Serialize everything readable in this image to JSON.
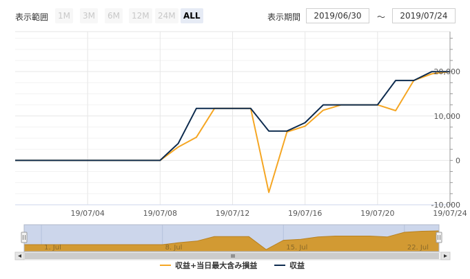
{
  "toolbar": {
    "range_label": "表示範囲",
    "range_buttons": [
      {
        "label": "1M",
        "active": false
      },
      {
        "label": "3M",
        "active": false
      },
      {
        "label": "6M",
        "active": false
      },
      {
        "label": "12M",
        "active": false
      },
      {
        "label": "24M",
        "active": false
      },
      {
        "label": "ALL",
        "active": true
      }
    ],
    "period_label": "表示期間",
    "start_date": "2019/06/30",
    "tilde": "～",
    "end_date": "2019/07/24"
  },
  "colors": {
    "series_orange": "#f5a623",
    "series_navy": "#0d2b4e",
    "navigator_fill": "#d29a33",
    "navigator_mask": "#ccd6eb",
    "grid": "#e6e6e6"
  },
  "chart_data": {
    "type": "line",
    "x_start": "2019/06/30",
    "x_end": "2019/07/24",
    "xticks": [
      "19/07/04",
      "19/07/08",
      "19/07/12",
      "19/07/16",
      "19/07/20",
      "19/07/24"
    ],
    "yticks": [
      "-10,000",
      "0",
      "10,000",
      "20,000"
    ],
    "ylim": [
      -10000,
      29000
    ],
    "grid": true,
    "legend_position": "bottom",
    "series": [
      {
        "name": "収益+当日最大含み損益",
        "color": "#f5a623",
        "x": [
          "2019/06/30",
          "2019/07/01",
          "2019/07/02",
          "2019/07/03",
          "2019/07/04",
          "2019/07/05",
          "2019/07/06",
          "2019/07/07",
          "2019/07/08",
          "2019/07/09",
          "2019/07/10",
          "2019/07/11",
          "2019/07/12",
          "2019/07/13",
          "2019/07/14",
          "2019/07/15",
          "2019/07/16",
          "2019/07/17",
          "2019/07/18",
          "2019/07/19",
          "2019/07/20",
          "2019/07/21",
          "2019/07/22",
          "2019/07/23",
          "2019/07/24"
        ],
        "values": [
          0,
          0,
          0,
          0,
          0,
          0,
          0,
          0,
          0,
          3000,
          5200,
          11700,
          11700,
          11700,
          -7200,
          6400,
          7700,
          11300,
          12500,
          12500,
          12500,
          11200,
          18000,
          19500,
          20000
        ]
      },
      {
        "name": "収益",
        "color": "#0d2b4e",
        "x": [
          "2019/06/30",
          "2019/07/01",
          "2019/07/02",
          "2019/07/03",
          "2019/07/04",
          "2019/07/05",
          "2019/07/06",
          "2019/07/07",
          "2019/07/08",
          "2019/07/09",
          "2019/07/10",
          "2019/07/11",
          "2019/07/12",
          "2019/07/13",
          "2019/07/14",
          "2019/07/15",
          "2019/07/16",
          "2019/07/17",
          "2019/07/18",
          "2019/07/19",
          "2019/07/20",
          "2019/07/21",
          "2019/07/22",
          "2019/07/23",
          "2019/07/24"
        ],
        "values": [
          0,
          0,
          0,
          0,
          0,
          0,
          0,
          0,
          0,
          3800,
          11700,
          11700,
          11700,
          11700,
          6600,
          6600,
          8500,
          12500,
          12500,
          12500,
          12500,
          18000,
          18000,
          20000,
          20000
        ]
      }
    ],
    "navigator": {
      "labels": [
        "1. Jul",
        "8. Jul",
        "15. Jul",
        "22. Jul"
      ],
      "label_dates": [
        "2019/07/01",
        "2019/07/08",
        "2019/07/15",
        "2019/07/22"
      ]
    }
  }
}
